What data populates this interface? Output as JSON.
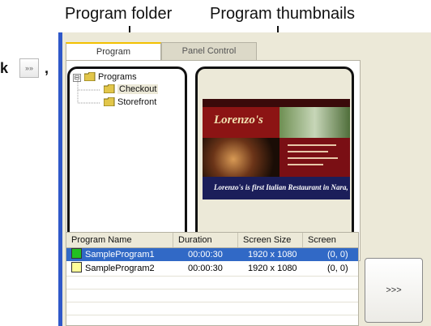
{
  "callouts": {
    "folder": "Program folder",
    "thumbnails": "Program thumbnails"
  },
  "fragment": {
    "letter": "k",
    "comma": ",",
    "button_label": "»»"
  },
  "tabs": [
    {
      "label": "Program"
    },
    {
      "label": "Panel Control"
    }
  ],
  "tree": {
    "root": "Programs",
    "expander": "⊟",
    "children": [
      {
        "label": "Checkout"
      },
      {
        "label": "Storefront"
      }
    ]
  },
  "thumbnail": {
    "brand": "Lorenzo's",
    "caption": "Lorenzo's is first Italian Restaurant in Nara, whic"
  },
  "grid": {
    "columns": [
      "Program Name",
      "Duration",
      "Screen Size",
      "Screen Pos..."
    ],
    "rows": [
      {
        "name": "SampleProgram1",
        "duration": "00:00:30",
        "size": "1920 x 1080",
        "pos": "(0, 0)",
        "color": "#22c022",
        "selected": true
      },
      {
        "name": "SampleProgram2",
        "duration": "00:00:30",
        "size": "1920 x 1080",
        "pos": "(0, 0)",
        "color": "#ffff99",
        "selected": false
      }
    ]
  },
  "next_button": ">>>",
  "colors": {
    "accent_blue": "#3169c6",
    "window_bg": "#ece9d8",
    "tab_highlight": "#f2c000"
  }
}
